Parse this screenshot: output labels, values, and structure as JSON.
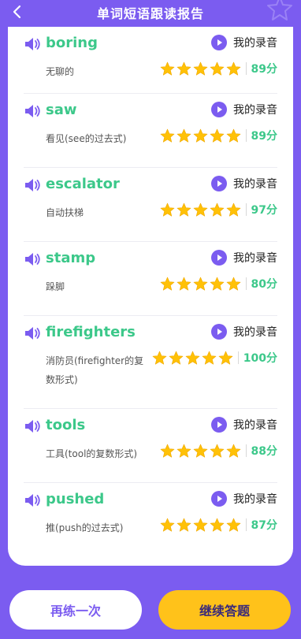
{
  "header": {
    "title": "单词短语跟读报告"
  },
  "colors": {
    "accent": "#7B5CF0",
    "word": "#3CC88A",
    "star": "#FFC107",
    "continue_bg": "#FFC21A"
  },
  "items": [
    {
      "word": "boring",
      "meaning": "无聊的",
      "rec_label": "我的录音",
      "stars": 5,
      "score": "89分"
    },
    {
      "word": "saw",
      "meaning": "看见(see的过去式)",
      "rec_label": "我的录音",
      "stars": 5,
      "score": "89分"
    },
    {
      "word": "escalator",
      "meaning": "自动扶梯",
      "rec_label": "我的录音",
      "stars": 5,
      "score": "97分"
    },
    {
      "word": "stamp",
      "meaning": "跺脚",
      "rec_label": "我的录音",
      "stars": 5,
      "score": "80分"
    },
    {
      "word": "firefighters",
      "meaning": "消防员(firefighter的复数形式)",
      "rec_label": "我的录音",
      "stars": 5,
      "score": "100分"
    },
    {
      "word": "tools",
      "meaning": "工具(tool的复数形式)",
      "rec_label": "我的录音",
      "stars": 5,
      "score": "88分"
    },
    {
      "word": "pushed",
      "meaning": "推(push的过去式)",
      "rec_label": "我的录音",
      "stars": 5,
      "score": "87分"
    }
  ],
  "buttons": {
    "retry": "再练一次",
    "continue": "继续答题"
  }
}
